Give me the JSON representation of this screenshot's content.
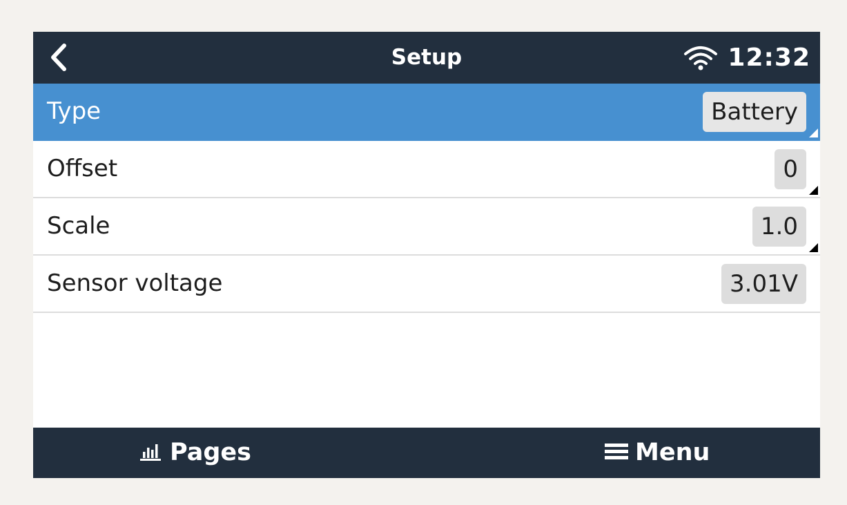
{
  "header": {
    "title": "Setup",
    "back_icon": "chevron-left-icon",
    "wifi_icon": "wifi-icon",
    "clock": "12:32"
  },
  "rows": [
    {
      "label": "Type",
      "value": "Battery",
      "selected": true,
      "editable": true
    },
    {
      "label": "Offset",
      "value": "0",
      "selected": false,
      "editable": true
    },
    {
      "label": "Scale",
      "value": "1.0",
      "selected": false,
      "editable": true
    },
    {
      "label": "Sensor voltage",
      "value": "3.01V",
      "selected": false,
      "editable": false
    }
  ],
  "footer": {
    "pages_label": "Pages",
    "pages_icon": "bar-chart-icon",
    "menu_label": "Menu",
    "menu_icon": "hamburger-menu-icon"
  },
  "colors": {
    "header_bg": "#222f3e",
    "selected_bg": "#4790d0",
    "value_bg": "#dddddd"
  }
}
